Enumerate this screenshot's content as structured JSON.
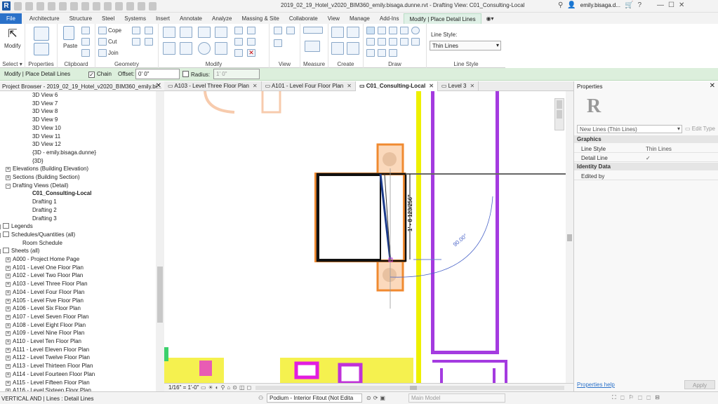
{
  "title_bar": {
    "document_title": "2019_02_19_Hotel_v2020_BIM360_emily.bisaga.dunne.rvt - Drafting View: C01_Consulting-Local",
    "username": "emily.bisaga.d..."
  },
  "ribbon_tabs": [
    "File",
    "Architecture",
    "Structure",
    "Steel",
    "Systems",
    "Insert",
    "Annotate",
    "Analyze",
    "Massing & Site",
    "Collaborate",
    "View",
    "Manage",
    "Add-Ins",
    "Modify | Place Detail Lines"
  ],
  "ribbon": {
    "select": {
      "modify_label": "Modify",
      "panel_label": "Select ▾"
    },
    "properties": {
      "panel_label": "Properties"
    },
    "clipboard": {
      "paste_label": "Paste",
      "panel_label": "Clipboard"
    },
    "geometry": {
      "cope": "Cope",
      "cut": "Cut",
      "join": "Join",
      "panel_label": "Geometry"
    },
    "modify": {
      "panel_label": "Modify"
    },
    "view": {
      "panel_label": "View"
    },
    "measure": {
      "panel_label": "Measure"
    },
    "create": {
      "panel_label": "Create"
    },
    "draw": {
      "panel_label": "Draw"
    },
    "line_style": {
      "label": "Line Style:",
      "value": "Thin Lines",
      "panel_label": "Line Style"
    }
  },
  "options_bar": {
    "context": "Modify | Place Detail Lines",
    "chain": "Chain",
    "chain_checked": true,
    "offset_label": "Offset:",
    "offset_value": "0' 0\"",
    "radius": "Radius:",
    "radius_value": "1' 0\""
  },
  "project_browser": {
    "title": "Project Browser - 2019_02_19_Hotel_v2020_BIM360_emily.bi...",
    "items": [
      {
        "label": "3D View 6",
        "indent": 46
      },
      {
        "label": "3D View 7",
        "indent": 46
      },
      {
        "label": "3D View 8",
        "indent": 46
      },
      {
        "label": "3D View 9",
        "indent": 46
      },
      {
        "label": "3D View 10",
        "indent": 46
      },
      {
        "label": "3D View 11",
        "indent": 46
      },
      {
        "label": "3D View 12",
        "indent": 46
      },
      {
        "label": "{3D - emily.bisaga.dunne}",
        "indent": 46
      },
      {
        "label": "{3D}",
        "indent": 46
      },
      {
        "label": "Elevations (Building Elevation)",
        "indent": 18,
        "exp": "+"
      },
      {
        "label": "Sections (Building Section)",
        "indent": 18,
        "exp": "+"
      },
      {
        "label": "Drafting Views (Detail)",
        "indent": 18,
        "exp": "−"
      },
      {
        "label": "C01_Consulting-Local",
        "indent": 46,
        "bold": true
      },
      {
        "label": "Drafting 1",
        "indent": 46
      },
      {
        "label": "Drafting 2",
        "indent": 46
      },
      {
        "label": "Drafting 3",
        "indent": 46
      },
      {
        "label": "Legends",
        "indent": 4,
        "exp": "+",
        "icon": true
      },
      {
        "label": "Schedules/Quantities (all)",
        "indent": 4,
        "exp": "−",
        "icon": true
      },
      {
        "label": "Room Schedule",
        "indent": 32
      },
      {
        "label": "Sheets (all)",
        "indent": 4,
        "exp": "−",
        "icon": true
      },
      {
        "label": "A000 - Project Home Page",
        "indent": 18,
        "exp": "+"
      },
      {
        "label": "A101 - Level  One Floor Plan",
        "indent": 18,
        "exp": "+"
      },
      {
        "label": "A102 - Level  Two Floor Plan",
        "indent": 18,
        "exp": "+"
      },
      {
        "label": "A103 - Level  Three Floor Plan",
        "indent": 18,
        "exp": "+"
      },
      {
        "label": "A104 - Level  Four Floor Plan",
        "indent": 18,
        "exp": "+"
      },
      {
        "label": "A105 - Level  Five Floor Plan",
        "indent": 18,
        "exp": "+"
      },
      {
        "label": "A106 - Level  Six Floor Plan",
        "indent": 18,
        "exp": "+"
      },
      {
        "label": "A107 - Level  Seven Floor Plan",
        "indent": 18,
        "exp": "+"
      },
      {
        "label": "A108 - Level  Eight Floor Plan",
        "indent": 18,
        "exp": "+"
      },
      {
        "label": "A109 - Level  Nine Floor Plan",
        "indent": 18,
        "exp": "+"
      },
      {
        "label": "A110 - Level  Ten Floor Plan",
        "indent": 18,
        "exp": "+"
      },
      {
        "label": "A111 - Level  Eleven Floor Plan",
        "indent": 18,
        "exp": "+"
      },
      {
        "label": "A112 - Level  Twelve Floor Plan",
        "indent": 18,
        "exp": "+"
      },
      {
        "label": "A113 - Level  Thirteen Floor Plan",
        "indent": 18,
        "exp": "+"
      },
      {
        "label": "A114 - Level  Fourteen Floor Plan",
        "indent": 18,
        "exp": "+"
      },
      {
        "label": "A115 - Level  Fifteen Floor Plan",
        "indent": 18,
        "exp": "+"
      },
      {
        "label": "A116 - Level  Sixteen Floor Plan",
        "indent": 18,
        "exp": "+"
      }
    ]
  },
  "view_tabs": [
    {
      "label": "A103 - Level  Three Floor Plan",
      "active": false
    },
    {
      "label": "A101 - Level  Four Floor Plan",
      "active": false
    },
    {
      "label": "C01_Consulting-Local",
      "active": true
    },
    {
      "label": "Level 3",
      "active": false
    }
  ],
  "canvas": {
    "dimension_text": "1' - 8 123/256\"",
    "angle_text": "90.00°"
  },
  "view_control_bar": {
    "scale": "1/16\" = 1'-0\""
  },
  "properties": {
    "title": "Properties",
    "type_selector": "New Lines (Thin Lines)",
    "edit_type": "Edit Type",
    "groups": [
      {
        "name": "Graphics",
        "rows": [
          {
            "k": "Line Style",
            "v": "Thin Lines"
          },
          {
            "k": "Detail Line",
            "v": "✓"
          }
        ]
      },
      {
        "name": "Identity Data",
        "rows": [
          {
            "k": "Edited by",
            "v": ""
          }
        ]
      }
    ],
    "help_link": "Properties help",
    "apply": "Apply"
  },
  "status_bar": {
    "message": "VERTICAL AND | Lines : Detail Lines",
    "workset": "Podium - Interior Fitout (Not Edita",
    "model": "Main Model"
  },
  "colors": {
    "accent": "#2a71c9",
    "context_green": "#dcefdc",
    "wall_purple": "#9b30d8",
    "orange": "#f0a060",
    "yellow": "#f2f200"
  }
}
